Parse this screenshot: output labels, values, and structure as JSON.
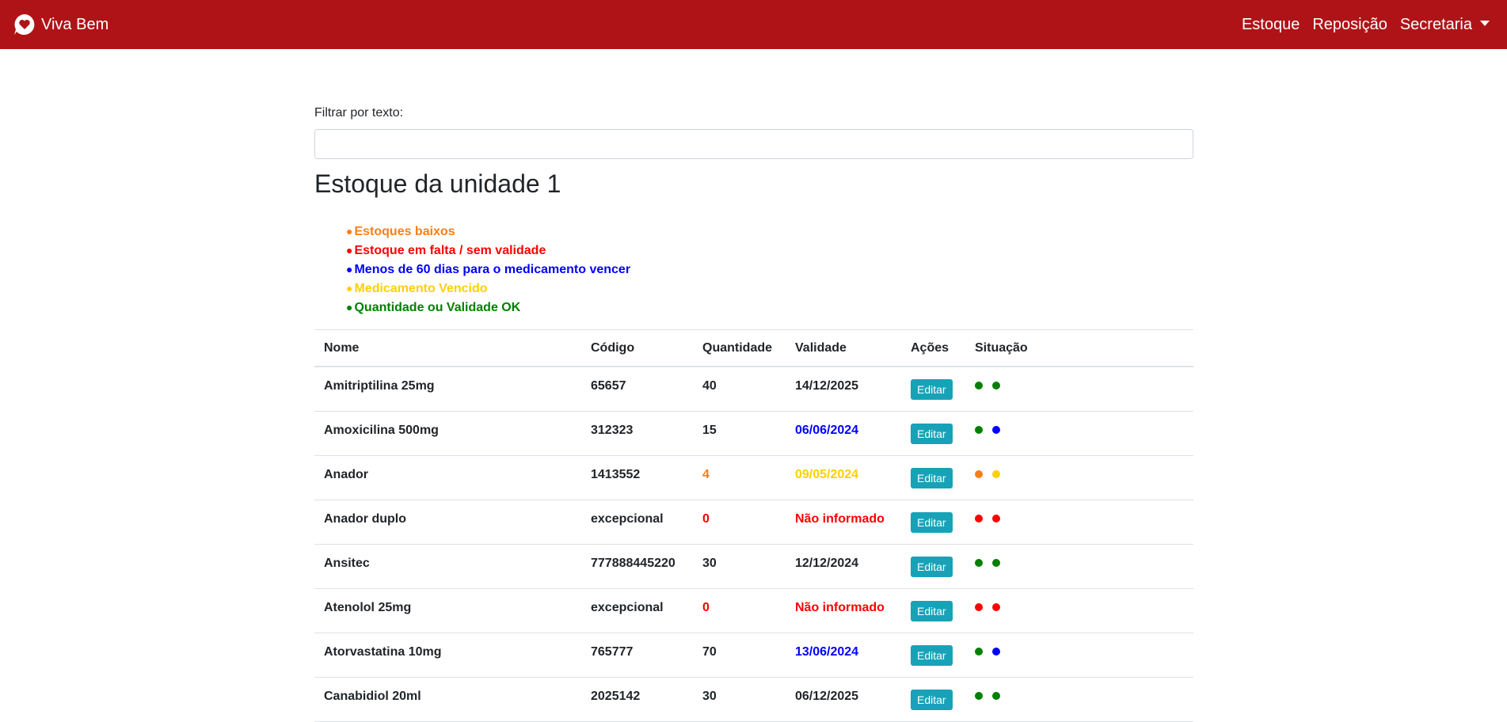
{
  "navbar": {
    "brand": "Viva Bem",
    "links": [
      "Estoque",
      "Reposição",
      "Secretaria"
    ],
    "bg_color": "#b01317"
  },
  "filter": {
    "label": "Filtrar por texto:",
    "value": "",
    "placeholder": ""
  },
  "page_title": "Estoque da unidade 1",
  "legend": [
    {
      "label": "Estoques baixos",
      "color": "#fd7e14"
    },
    {
      "label": "Estoque em falta / sem validade",
      "color": "#ff0000"
    },
    {
      "label": "Menos de 60 dias para o medicamento vencer",
      "color": "#0000ff"
    },
    {
      "label": "Medicamento Vencido",
      "color": "#ffd000"
    },
    {
      "label": "Quantidade ou Validade OK",
      "color": "#008000"
    }
  ],
  "table": {
    "headers": [
      "Nome",
      "Código",
      "Quantidade",
      "Validade",
      "Ações",
      "Situação"
    ],
    "edit_label": "Editar",
    "rows": [
      {
        "name": "Amitriptilina 25mg",
        "code": "65657",
        "quantity": "40",
        "quantity_color": "#212529",
        "validity": "14/12/2025",
        "validity_color": "#212529",
        "status": [
          "#008000",
          "#008000"
        ]
      },
      {
        "name": "Amoxicilina 500mg",
        "code": "312323",
        "quantity": "15",
        "quantity_color": "#212529",
        "validity": "06/06/2024",
        "validity_color": "#0000ff",
        "status": [
          "#008000",
          "#0000ff"
        ]
      },
      {
        "name": "Anador",
        "code": "1413552",
        "quantity": "4",
        "quantity_color": "#fd7e14",
        "validity": "09/05/2024",
        "validity_color": "#ffd000",
        "status": [
          "#fd7e14",
          "#ffd000"
        ]
      },
      {
        "name": "Anador duplo",
        "code": "excepcional",
        "quantity": "0",
        "quantity_color": "#ff0000",
        "validity": "Não informado",
        "validity_color": "#ff0000",
        "status": [
          "#ff0000",
          "#ff0000"
        ]
      },
      {
        "name": "Ansitec",
        "code": "777888445220",
        "quantity": "30",
        "quantity_color": "#212529",
        "validity": "12/12/2024",
        "validity_color": "#212529",
        "status": [
          "#008000",
          "#008000"
        ]
      },
      {
        "name": "Atenolol 25mg",
        "code": "excepcional",
        "quantity": "0",
        "quantity_color": "#ff0000",
        "validity": "Não informado",
        "validity_color": "#ff0000",
        "status": [
          "#ff0000",
          "#ff0000"
        ]
      },
      {
        "name": "Atorvastatina 10mg",
        "code": "765777",
        "quantity": "70",
        "quantity_color": "#212529",
        "validity": "13/06/2024",
        "validity_color": "#0000ff",
        "status": [
          "#008000",
          "#0000ff"
        ]
      },
      {
        "name": "Canabidiol 20ml",
        "code": "2025142",
        "quantity": "30",
        "quantity_color": "#212529",
        "validity": "06/12/2025",
        "validity_color": "#212529",
        "status": [
          "#008000",
          "#008000"
        ]
      }
    ]
  }
}
